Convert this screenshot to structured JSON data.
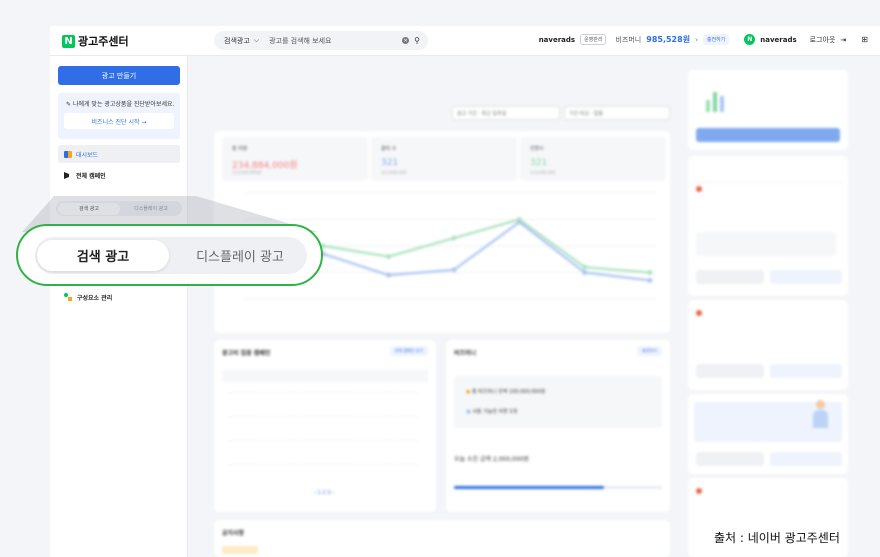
{
  "header": {
    "logo_letter": "N",
    "logo_text": "광고주센터",
    "search_type": "검색광고",
    "search_placeholder": "광고를 검색해 보세요",
    "account": "naverads",
    "role": "운영관리",
    "money_label": "비즈머니",
    "money_value": "985,528원",
    "charge_label": "충전하기",
    "user_letter": "N",
    "user_name": "naverads",
    "logout": "로그아웃"
  },
  "sidebar": {
    "create_button": "광고 만들기",
    "diagnosis_text": "나에게 맞는 광고상품을 진단받아보세요.",
    "diagnosis_button": "비즈니스 진단 시작 →",
    "dashboard": "대시보드",
    "all_campaigns": "전체 캠페인",
    "small_tabs": [
      "검색 광고",
      "디스플레이 광고"
    ],
    "asset_manage": "구성요소 관리"
  },
  "main": {
    "filters": [
      "광고 기간 · 최근 일주일",
      "기간 비교 · 없음"
    ],
    "kpis": [
      {
        "label": "총 비용",
        "value": "234,884,000원",
        "sub": "123,000,000원",
        "color": "#f08080"
      },
      {
        "label": "클릭 수",
        "value": "321",
        "sub": "123,000,000",
        "color": "#7fa9ef"
      },
      {
        "label": "전환수",
        "value": "321",
        "sub": "123,000,000",
        "color": "#7fd6a0"
      }
    ],
    "ad_card_title": "광고비 집중 캠페인",
    "ad_card_button": "전체 캠페인 보기",
    "bizmoney_title": "비즈머니",
    "bizmoney_button": "충전하기",
    "bizmoney_balance_label": "총 비즈머니 잔액",
    "bizmoney_balance": "100,000,000원",
    "coupon_label": "사용 가능한 쿠폰",
    "coupon_count": "5개",
    "today_spent": "오늘 소진 금액 2,000,000원",
    "notice_title": "공지사항"
  },
  "chart_data": {
    "type": "line",
    "categories": [
      "",
      "",
      "",
      "",
      "",
      "",
      ""
    ],
    "series": [
      {
        "values": [
          40,
          24,
          8,
          12,
          48,
          10,
          4
        ],
        "color": "#a9c4f5"
      },
      {
        "values": [
          42,
          30,
          22,
          36,
          50,
          14,
          10
        ],
        "color": "#a9e2c0"
      }
    ],
    "ylim": [
      -10,
      70
    ]
  },
  "magnifier": {
    "tab_active": "검색 광고",
    "tab_inactive": "디스플레이 광고"
  },
  "source": "출처 : 네이버 광고주센터"
}
